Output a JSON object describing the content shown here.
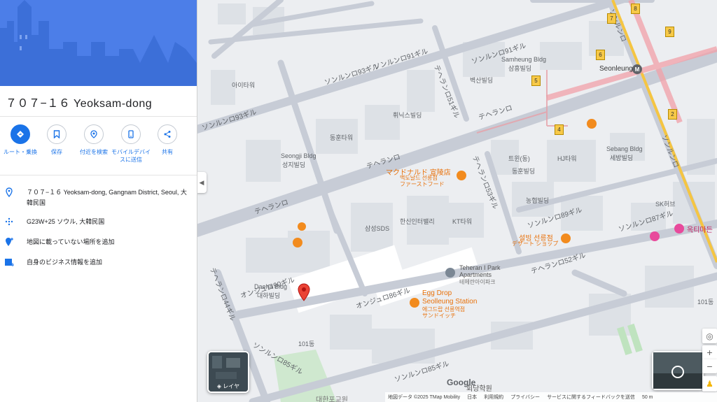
{
  "place": {
    "title": "７０７−１６ Yeoksam-dong",
    "actions": [
      {
        "label": "ルート・乗換",
        "icon": "directions-icon"
      },
      {
        "label": "保存",
        "icon": "bookmark-icon"
      },
      {
        "label": "付近を検索",
        "icon": "nearby-search-icon"
      },
      {
        "label": "モバイルデバイスに送信",
        "icon": "send-to-phone-icon"
      },
      {
        "label": "共有",
        "icon": "share-icon"
      }
    ],
    "info": [
      {
        "text": "７０７−１６ Yeoksam-dong, Gangnam District, Seoul, 大韓民国",
        "icon": "location-pin-icon"
      },
      {
        "text": "G23W+25 ソウル, 大韓民国",
        "icon": "plus-code-icon"
      },
      {
        "text": "地図に載っていない場所を追加",
        "icon": "add-place-icon"
      },
      {
        "text": "自身のビジネス情報を追加",
        "icon": "add-business-icon"
      }
    ]
  },
  "map": {
    "station": "Seonleung",
    "pois": {
      "mcd": "マクドナルド 宣陵店",
      "mcd_ko": "맥도날드 선릉점",
      "mcd_ja": "ファーストフード",
      "teheran": "Teheran I Park",
      "teheran2": "Apartments",
      "teheran_ko": "테헤란아이파크",
      "egg": "Egg Drop",
      "egg2": "Seolleung Station",
      "egg_ko": "에그드랍 선릉역점",
      "egg_ja": "サンドイッチ",
      "seolbing": "설빙 선릉점",
      "seolbing_ja": "デザート ショップ",
      "okdo": "옥티마든"
    },
    "roads": {
      "teheran_main1": "テヘランロ",
      "teheran_main2": "テヘランロ",
      "teheran_main3": "テヘランロ",
      "seolleung1": "ソンルンロ",
      "seolleung2": "ソンルンロ",
      "r93": "ソンルンロ93ギル",
      "r91": "ソンルンロ91ギル",
      "r86": "オンジュロ86ギル",
      "r85a": "ソンルンロ85ギル",
      "r85b": "ソンルンロ85ギル",
      "r89": "ソンルンロ89ギル",
      "r87": "ソンルンロ87ギル",
      "r52": "テヘランロ52ギル",
      "r51": "テヘランロ51ギル",
      "r90": "オンジュロ90ギル",
      "r44": "テヘランロ44ギル",
      "r53": "テヘランロ53ギル"
    },
    "buildings": [
      "Seongji Bldg",
      "성지빌딩",
      "Samheung Bldg",
      "삼흥빌딩",
      "Daeha Bldg",
      "대하빌딩",
      "HJ타워",
      "Sebang Bldg",
      "세방빌딩",
      "SK허브",
      "101동",
      "101동",
      "동훈타워",
      "아이타워",
      "벽산빌딩",
      "휘닉스빌딩",
      "삼성SDS",
      "한신인터밸리",
      "KT타워",
      "농협빌딩",
      "트윈(동)",
      "동훈빌딩"
    ],
    "numbered_exits": [
      "2",
      "4",
      "5",
      "6",
      "7",
      "8",
      "9"
    ],
    "layers_label": "レイヤ",
    "google_logo": "Google",
    "footer": [
      "地図データ ©2025 TMap Mobility",
      "日本",
      "利用規約",
      "プライバシー",
      "サービスに関するフィードバックを送信",
      "50 m"
    ],
    "bottom_place": "대한포교원",
    "bottom_place2": "회당학원"
  }
}
